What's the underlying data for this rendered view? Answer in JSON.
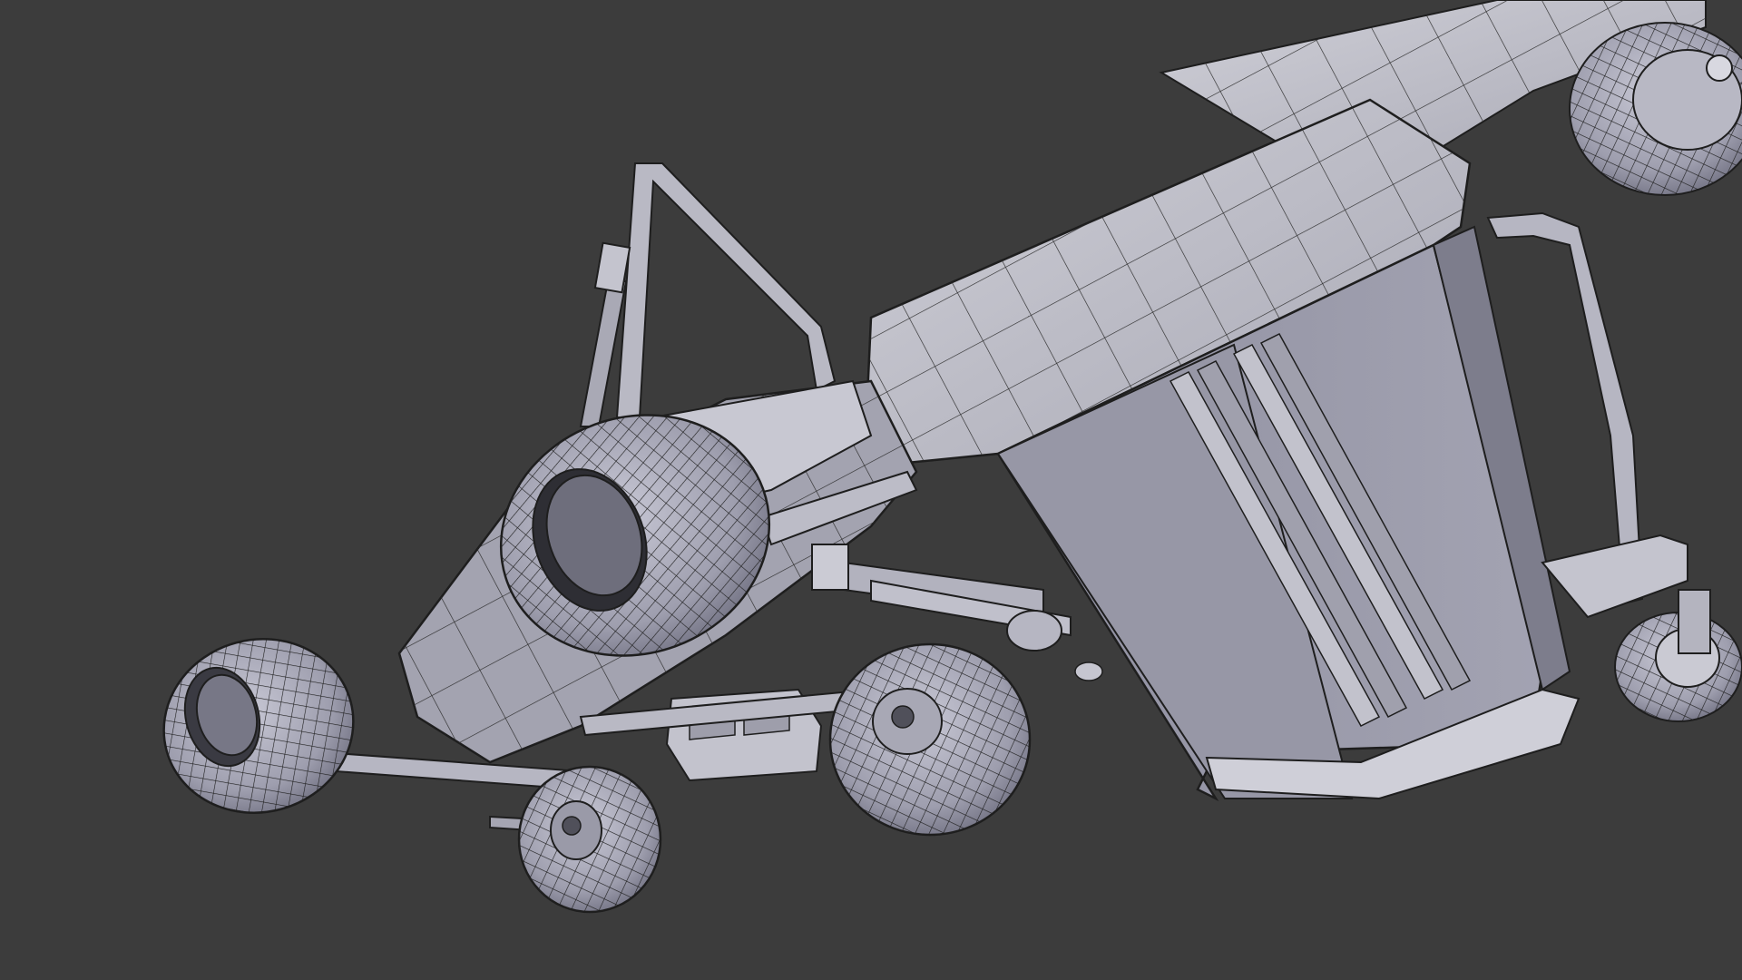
{
  "viewport": {
    "background_color": "#3c3c3c",
    "shading": "solid-with-wireframe",
    "mesh_color": "#c8c8d0",
    "wire_color": "#1e1e1e",
    "shade_color": "#8a8a96"
  },
  "scene": {
    "object": "mower-vehicle-mesh"
  }
}
